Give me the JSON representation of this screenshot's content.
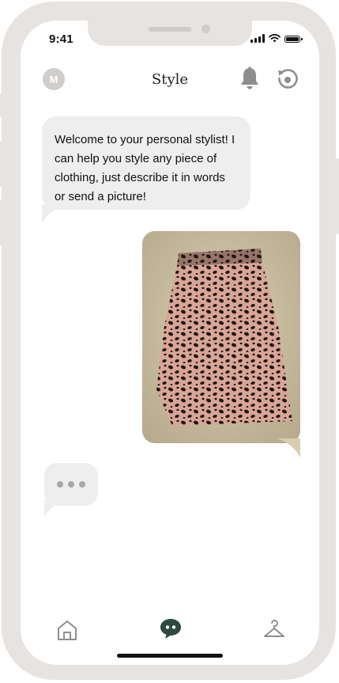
{
  "status_bar": {
    "time": "9:41"
  },
  "header": {
    "avatar_initial": "M",
    "title": "Style",
    "notifications_icon": "bell-icon",
    "refresh_icon": "refresh-icon"
  },
  "chat": {
    "messages": [
      {
        "from": "stylist",
        "text": "Welcome to your personal stylist! I can help you style any piece of clothing, just describe it in words or send a picture!"
      },
      {
        "from": "user",
        "type": "image",
        "description_icon": "leopard-print-skirt-photo"
      }
    ],
    "typing_indicator": true
  },
  "bottom_nav": {
    "items": [
      {
        "icon": "home-icon"
      },
      {
        "icon": "chat-icon",
        "active": true
      },
      {
        "icon": "hanger-icon"
      }
    ]
  },
  "colors": {
    "frame": "#e6e3e1",
    "bubble": "#eeeeee",
    "accent": "#2e4a40",
    "icon_gray": "#8e8e8e"
  }
}
